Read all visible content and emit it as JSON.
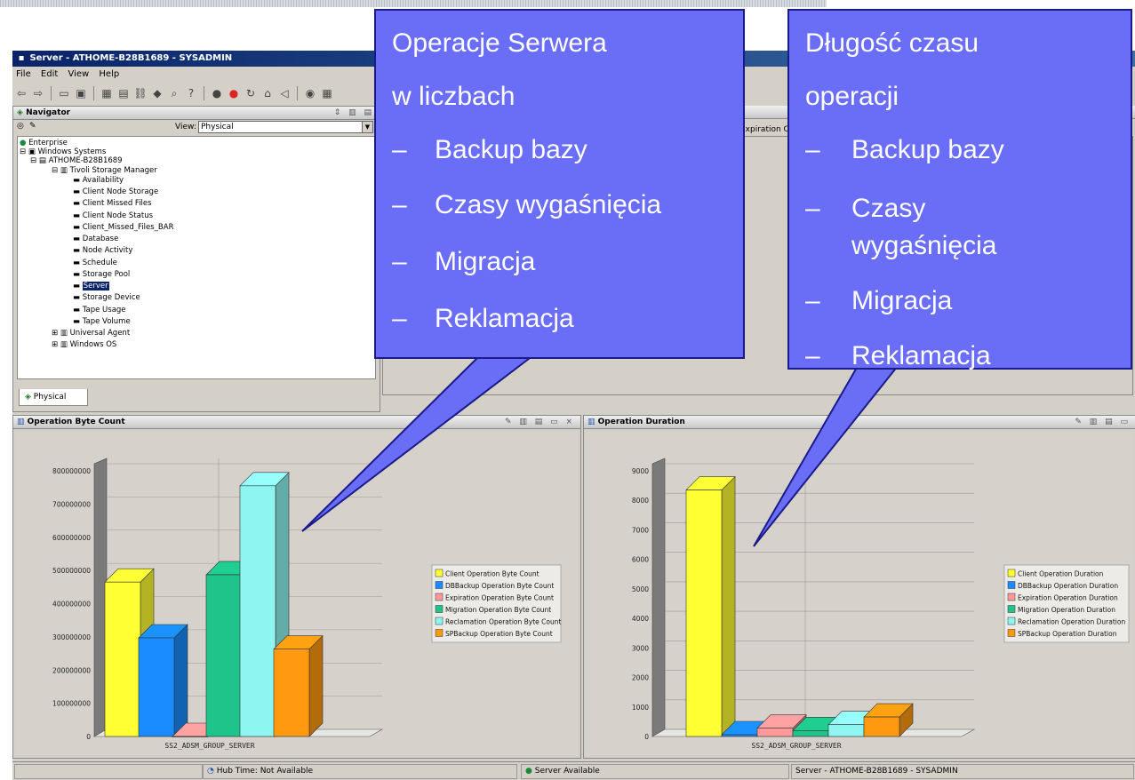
{
  "window": {
    "title": "Server - ATHOME-B28B1689 - SYSADMIN",
    "menu": [
      "File",
      "Edit",
      "View",
      "Help"
    ]
  },
  "navigator": {
    "title": "Navigator",
    "view_label": "View:",
    "view_value": "Physical",
    "tab_label": "Physical",
    "tree": {
      "enterprise": "Enterprise",
      "windows_systems": "Windows Systems",
      "host": "ATHOME-B28B1689",
      "tsm": "Tivoli Storage Manager",
      "items": [
        "Availability",
        "Client Node Storage",
        "Client Missed Files",
        "Client Node Status",
        "Client_Missed_Files_BAR",
        "Database",
        "Node Activity",
        "Schedule",
        "Storage Pool",
        "Server",
        "Storage Device",
        "Tape Usage",
        "Tape Volume"
      ],
      "selected": "Server",
      "universal_agent": "Universal Agent",
      "windows_os": "Windows OS"
    }
  },
  "table": {
    "partial_column": "Expiration C"
  },
  "status_bar": {
    "hub_time": "Hub Time: Not Available",
    "server_status": "Server Available",
    "session": "Server - ATHOME-B28B1689 - SYSADMIN"
  },
  "callouts": {
    "left": {
      "title_line1": "Operacje Serwera",
      "title_line2": "w liczbach",
      "items": [
        "Backup bazy",
        "Czasy wygaśnięcia",
        "Migracja",
        "Reklamacja"
      ]
    },
    "right": {
      "title_line1": "Długość czasu",
      "title_line2": "operacji",
      "items": [
        "Backup bazy",
        "Czasy",
        "wygaśnięcia",
        "Migracja",
        "Reklamacja"
      ]
    },
    "bullet": "–"
  },
  "colors": {
    "series": [
      "#ffff33",
      "#1a8cff",
      "#ff9a9a",
      "#1fc48a",
      "#8ff5f0",
      "#ff9a10"
    ],
    "callout_fill": "#6a6ef7"
  },
  "chart_data": [
    {
      "type": "bar",
      "panel_title": "Operation Byte Count",
      "categories": [
        "SS2_ADSM_GROUP_SERVER"
      ],
      "ylim": [
        0,
        800000000
      ],
      "yticks": [
        0,
        100000000,
        200000000,
        300000000,
        400000000,
        500000000,
        600000000,
        700000000,
        800000000
      ],
      "series": [
        {
          "name": "Client Operation Byte Count",
          "values": [
            465000000
          ]
        },
        {
          "name": "DBBackup Operation Byte Count",
          "values": [
            297000000
          ]
        },
        {
          "name": "Expiration Operation Byte Count",
          "values": [
            0
          ]
        },
        {
          "name": "Migration Operation Byte Count",
          "values": [
            487000000
          ]
        },
        {
          "name": "Reclamation Operation Byte Count",
          "values": [
            755000000
          ]
        },
        {
          "name": "SPBackup Operation Byte Count",
          "values": [
            263000000
          ]
        }
      ]
    },
    {
      "type": "bar",
      "panel_title": "Operation Duration",
      "categories": [
        "SS2_ADSM_GROUP_SERVER"
      ],
      "ylim": [
        0,
        9000
      ],
      "yticks": [
        0,
        1000,
        2000,
        3000,
        4000,
        5000,
        6000,
        7000,
        8000,
        9000
      ],
      "series": [
        {
          "name": "Client Operation Duration",
          "values": [
            8350
          ]
        },
        {
          "name": "DBBackup Operation Duration",
          "values": [
            60
          ]
        },
        {
          "name": "Expiration Operation Duration",
          "values": [
            280
          ]
        },
        {
          "name": "Migration Operation Duration",
          "values": [
            200
          ]
        },
        {
          "name": "Reclamation Operation Duration",
          "values": [
            400
          ]
        },
        {
          "name": "SPBackup Operation Duration",
          "values": [
            660
          ]
        }
      ]
    }
  ]
}
